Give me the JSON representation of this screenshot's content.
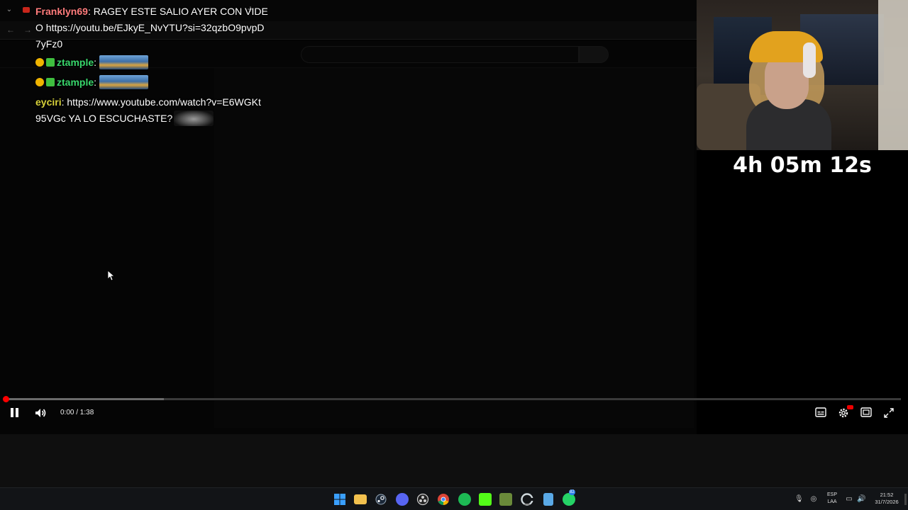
{
  "browser": {
    "tab_menu_icon": "chevron-down-icon",
    "new_tab_symbol": "+",
    "back_symbol": "←",
    "forward_symbol": "→"
  },
  "chat": {
    "messages": [
      {
        "user": "Franklyn69",
        "separator": ": ",
        "text": "RAGEY ESTE SALIO AYER CON VIDEO https://youtu.be/EJkyE_NvYTU?si=32qzbO9pvpD7yFz0"
      },
      {
        "user": "ztample",
        "separator": ": ",
        "emote": "emote-image"
      },
      {
        "user": "ztample",
        "separator": ": ",
        "emote": "emote-image"
      },
      {
        "user": "eyciri",
        "separator": ": ",
        "text": "https://www.youtube.com/watch?v=E6WGKt95VGc YA LO ESCUCHASTE?"
      }
    ]
  },
  "player": {
    "time": "0:00 / 1:38",
    "progress_fraction": 0.0,
    "buffer_fraction": 0.177,
    "controls_right": [
      "subtitles-icon",
      "settings-icon",
      "theater-mode-icon",
      "fullscreen-icon"
    ]
  },
  "stream": {
    "timer": "4h 05m 12s"
  },
  "taskbar": {
    "apps": [
      "windows-start-icon",
      "file-explorer-icon",
      "steam-icon",
      "discord-icon",
      "obs-icon",
      "chrome-icon",
      "spotify-icon",
      "kick-icon",
      "minecraft-icon",
      "chrome-dev-icon",
      "notepad-icon",
      "whatsapp-icon"
    ],
    "whatsapp_badge": "82",
    "lang_line1": "ESP",
    "lang_line2": "LAA",
    "time": "21:52",
    "date": "31/7/2026"
  },
  "colors": {
    "progress": "#ff0000",
    "user_franklyn": "#ff7c7c",
    "user_ztample": "#38d66b",
    "user_eyciri": "#d8d23a"
  }
}
